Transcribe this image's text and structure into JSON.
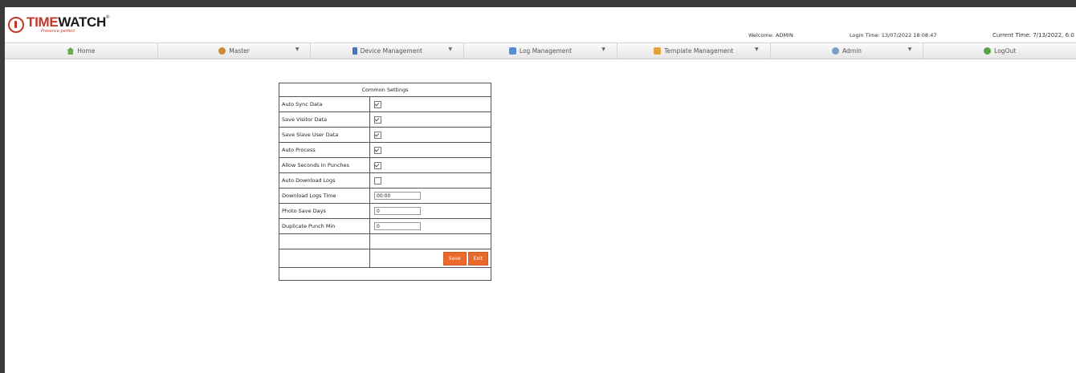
{
  "header": {
    "logo_red": "TIME",
    "logo_dark": "WATCH",
    "logo_reg": "®",
    "tagline": "Presence perfect",
    "welcome": "Welcome: ADMIN",
    "login_time": "Login Time: 13/07/2022 18:08:47",
    "current_time": "Current Time: 7/13/2022, 6:0"
  },
  "menu": [
    {
      "label": "Home",
      "icon": "home-icon",
      "dropdown": false
    },
    {
      "label": "Master",
      "icon": "master-icon",
      "dropdown": true,
      "caret": "▼"
    },
    {
      "label": "Device Management",
      "icon": "device-icon",
      "dropdown": true,
      "caret": "▼"
    },
    {
      "label": "Log Management",
      "icon": "log-icon",
      "dropdown": true,
      "caret": "▼"
    },
    {
      "label": "Template Management",
      "icon": "template-icon",
      "dropdown": true,
      "caret": "▼"
    },
    {
      "label": "Admin",
      "icon": "admin-icon",
      "dropdown": true,
      "caret": "▼"
    },
    {
      "label": "LogOut",
      "icon": "logout-icon",
      "dropdown": false
    }
  ],
  "settings": {
    "title": "Common Settings",
    "rows": [
      {
        "label": "Auto Sync Data",
        "type": "checkbox",
        "checked": true
      },
      {
        "label": "Save Visitor Data",
        "type": "checkbox",
        "checked": true
      },
      {
        "label": "Save Slave User Data",
        "type": "checkbox",
        "checked": true
      },
      {
        "label": "Auto Process",
        "type": "checkbox",
        "checked": true
      },
      {
        "label": "Allow Seconds In Punches",
        "type": "checkbox",
        "checked": true
      },
      {
        "label": "Auto Download Logs",
        "type": "checkbox",
        "checked": false
      },
      {
        "label": "Download Logs Time",
        "type": "text",
        "value": "00:00"
      },
      {
        "label": "Photo Save Days",
        "type": "text",
        "value": "0"
      },
      {
        "label": "Duplicate Punch Min",
        "type": "text",
        "value": "0"
      }
    ],
    "save_label": "Save",
    "exit_label": "Exit"
  },
  "colors": {
    "brand_red": "#c0392b",
    "button_orange": "#ea6a2d"
  }
}
